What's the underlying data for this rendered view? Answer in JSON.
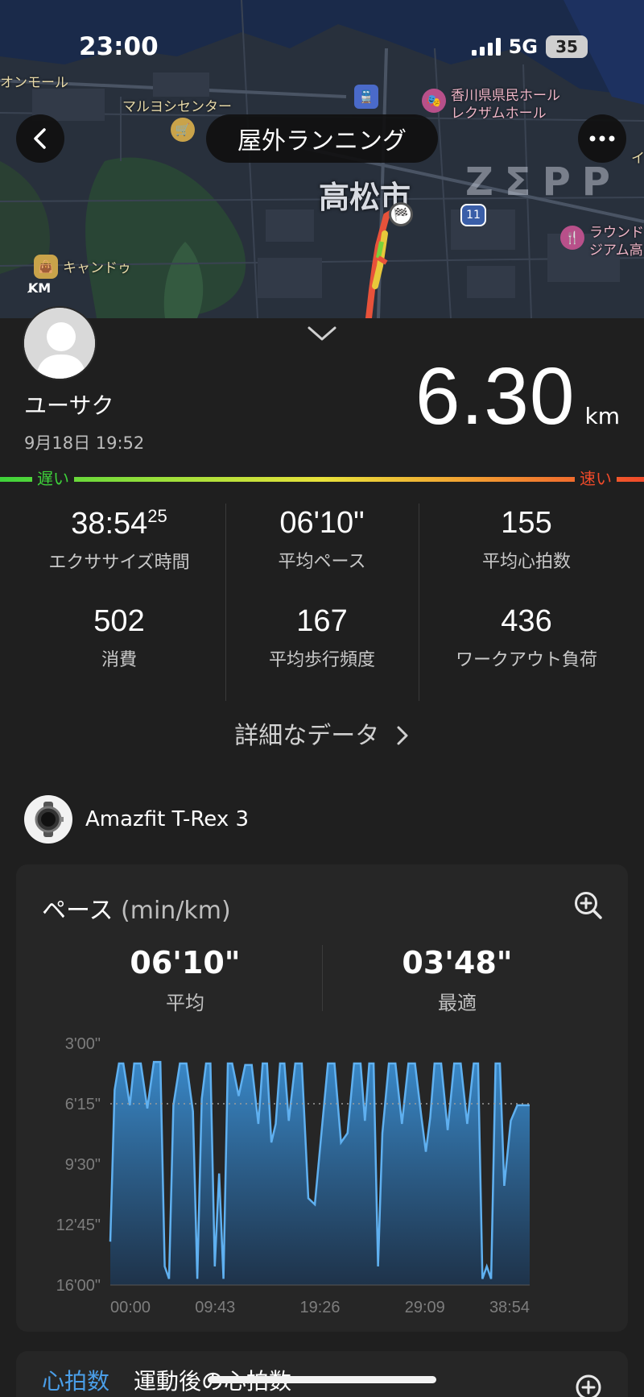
{
  "status_bar": {
    "time": "23:00",
    "network": "5G",
    "battery": "35"
  },
  "map": {
    "labels": {
      "aeon": "オンモール",
      "maruyoshi": "マルヨシセンター",
      "kagawa_hall_1": "香川県県民ホール",
      "kagawa_hall_2": "レクザムホール",
      "candou": "キャンドゥ",
      "round1_1": "ラウンド",
      "round1_2": "ジアム高",
      "right_edge": "イ",
      "route_number": "11",
      "city": "高松市",
      "watermark": "ZΣPP"
    }
  },
  "header": {
    "title": "屋外ランニング"
  },
  "profile": {
    "name": "ユーサク",
    "datetime": "9月18日 19:52"
  },
  "distance": {
    "value": "6.30",
    "unit": "km"
  },
  "pace_scale": {
    "slow": "遅い",
    "fast": "速い"
  },
  "stats": {
    "exercise_time": {
      "main": "38:54",
      "sup": "25",
      "label": "エクササイズ時間"
    },
    "avg_pace": {
      "value": "06'10\"",
      "label": "平均ペース"
    },
    "avg_hr": {
      "value": "155",
      "label": "平均心拍数"
    },
    "calories": {
      "value": "502",
      "label": "消費"
    },
    "cadence": {
      "value": "167",
      "label": "平均歩行頻度"
    },
    "load": {
      "value": "436",
      "label": "ワークアウト負荷"
    }
  },
  "details_link": "詳細なデータ",
  "device": {
    "name": "Amazfit T-Rex 3"
  },
  "pace_card": {
    "title": "ペース",
    "unit": "(min/km)",
    "avg": {
      "value": "06'10\"",
      "label": "平均"
    },
    "best": {
      "value": "03'48\"",
      "label": "最適"
    }
  },
  "chart_data": {
    "type": "area",
    "title": "ペース (min/km)",
    "y_tick_labels": [
      "3'00\"",
      "6'15\"",
      "9'30\"",
      "12'45\"",
      "16'00\""
    ],
    "x_tick_labels": [
      "00:00",
      "09:43",
      "19:26",
      "29:09",
      "38:54"
    ],
    "ylim_seconds": [
      180,
      960
    ],
    "y_inverted": true,
    "avg_line_seconds": 375,
    "x_minutes": [
      0,
      0.4,
      0.8,
      1.2,
      1.8,
      2.2,
      2.8,
      3.4,
      4.0,
      4.6,
      5.0,
      5.4,
      5.8,
      6.4,
      7.0,
      7.6,
      8.0,
      8.4,
      8.8,
      9.2,
      9.6,
      10.0,
      10.4,
      10.8,
      11.2,
      11.8,
      12.4,
      13.0,
      13.6,
      14.0,
      14.4,
      14.8,
      15.2,
      15.6,
      16.0,
      16.4,
      17.0,
      17.6,
      18.2,
      18.8,
      19.4,
      20.0,
      20.6,
      21.2,
      21.8,
      22.4,
      23.0,
      23.4,
      23.8,
      24.2,
      24.6,
      25.0,
      25.6,
      26.2,
      26.8,
      27.4,
      28.0,
      28.6,
      29.0,
      29.4,
      29.8,
      30.4,
      31.0,
      31.6,
      32.2,
      32.8,
      33.4,
      33.8,
      34.2,
      34.6,
      35.0,
      35.4,
      35.8,
      36.2,
      36.8,
      37.4,
      38.0,
      38.54
    ],
    "pace_seconds": [
      820,
      330,
      245,
      245,
      380,
      245,
      245,
      390,
      240,
      240,
      900,
      940,
      380,
      245,
      245,
      400,
      940,
      360,
      245,
      245,
      900,
      600,
      940,
      245,
      245,
      350,
      250,
      250,
      440,
      245,
      245,
      500,
      440,
      245,
      245,
      430,
      245,
      245,
      680,
      700,
      470,
      245,
      245,
      500,
      470,
      245,
      245,
      430,
      245,
      245,
      900,
      470,
      245,
      245,
      440,
      245,
      245,
      420,
      530,
      420,
      245,
      245,
      460,
      245,
      245,
      440,
      245,
      245,
      940,
      900,
      940,
      245,
      245,
      640,
      430,
      380,
      380,
      380
    ],
    "xlabel": "",
    "ylabel": ""
  },
  "hr_card": {
    "tab_hr": "心拍数",
    "tab_post": "運動後の心拍数"
  }
}
